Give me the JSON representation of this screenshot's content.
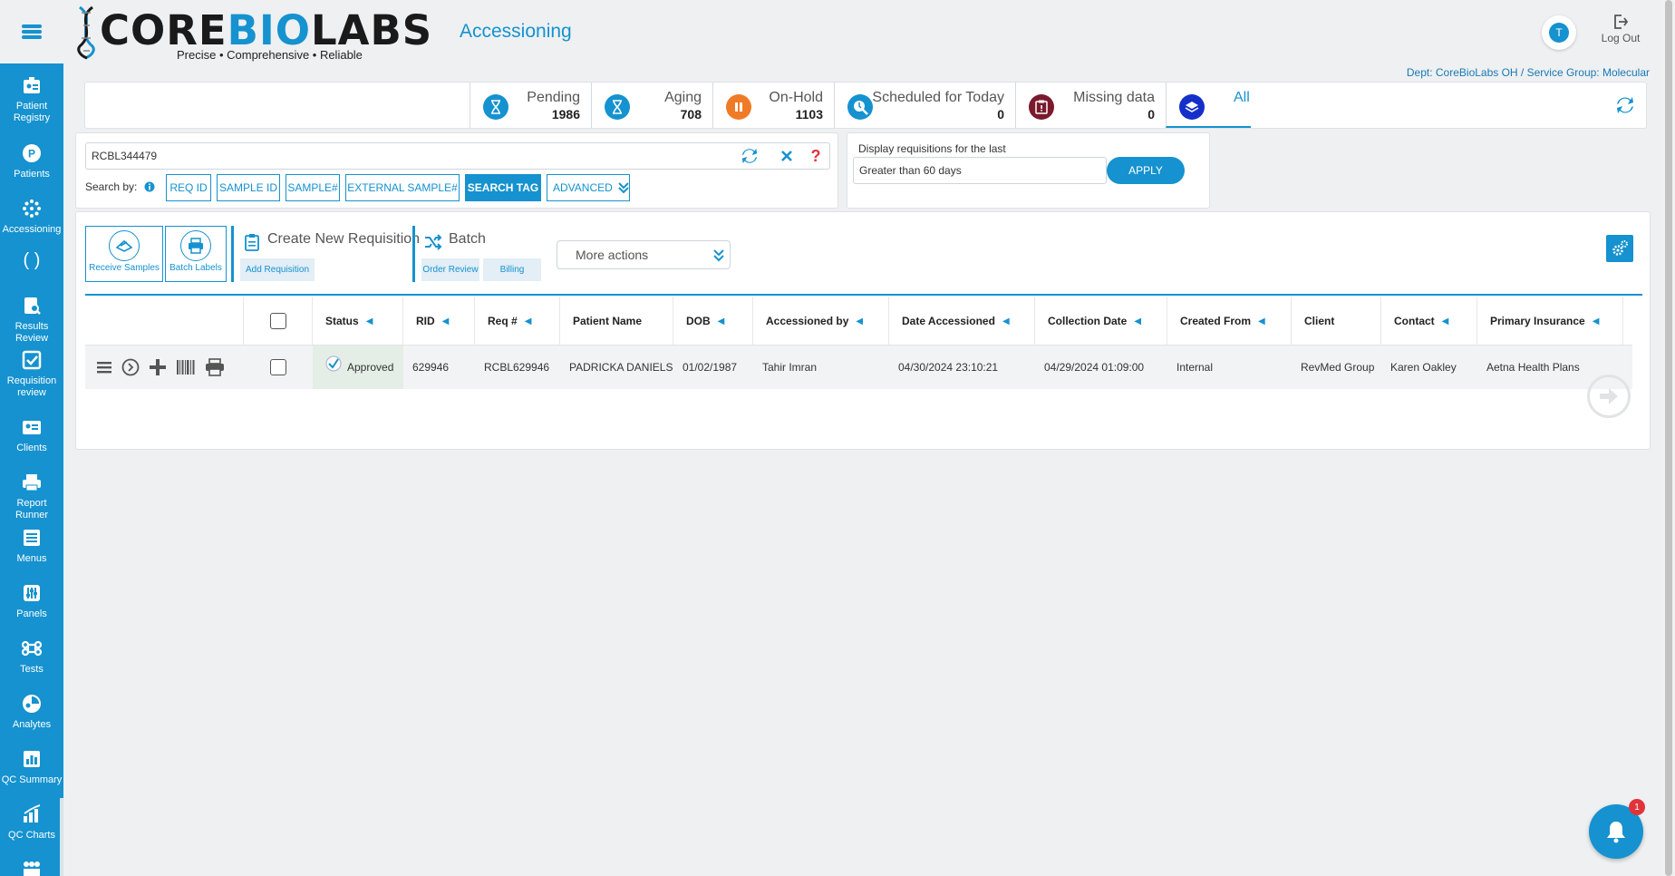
{
  "sidebar": {
    "items": [
      {
        "label": "Patient Registry",
        "icon": "patient-registry-icon"
      },
      {
        "label": "Patients",
        "icon": "patients-icon"
      },
      {
        "label": "Accessioning",
        "icon": "accessioning-icon"
      },
      {
        "label": "( )",
        "icon": "parentheses-icon"
      },
      {
        "label": "Results Review",
        "icon": "results-review-icon"
      },
      {
        "label": "Requisition review",
        "icon": "requisition-review-icon"
      },
      {
        "label": "Clients",
        "icon": "clients-icon"
      },
      {
        "label": "Report Runner",
        "icon": "report-runner-icon"
      },
      {
        "label": "Menus",
        "icon": "menus-icon"
      },
      {
        "label": "Panels",
        "icon": "panels-icon"
      },
      {
        "label": "Tests",
        "icon": "tests-icon"
      },
      {
        "label": "Analytes",
        "icon": "analytes-icon"
      },
      {
        "label": "QC Summary",
        "icon": "qc-summary-icon"
      },
      {
        "label": "QC Charts",
        "icon": "qc-charts-icon"
      }
    ]
  },
  "header": {
    "logo_part1": "CORE",
    "logo_part2": "BIO",
    "logo_part3": "LABS",
    "tagline": "Precise • Comprehensive • Reliable",
    "module_title": "Accessioning",
    "avatar_initial": "T",
    "logout_label": "Log Out",
    "dept": "Dept: CoreBioLabs OH / Service Group: Molecular"
  },
  "status_bar": {
    "pending": {
      "label": "Pending",
      "count": "1986"
    },
    "aging": {
      "label": "Aging",
      "count": "708"
    },
    "onhold": {
      "label": "On-Hold",
      "count": "1103"
    },
    "scheduled": {
      "label": "Scheduled for Today",
      "count": "0"
    },
    "missing": {
      "label": "Missing data",
      "count": "0"
    },
    "all": {
      "label": "All"
    }
  },
  "search": {
    "value": "RCBL344479",
    "search_by_label": "Search by:",
    "buttons": [
      "REQ ID",
      "SAMPLE ID",
      "SAMPLE#",
      "EXTERNAL SAMPLE#",
      "SEARCH TAG",
      "ADVANCED"
    ]
  },
  "date_filter": {
    "label": "Display requisitions for the last",
    "value": "Greater than 60 days",
    "apply_label": "APPLY"
  },
  "actions": {
    "receive_samples": "Receive Samples",
    "batch_labels": "Batch Labels",
    "create_requisition": "Create New Requisition",
    "add_requisition": "Add Requisition",
    "batch": "Batch",
    "order_review": "Order Review",
    "billing": "Billing",
    "more_actions": "More actions"
  },
  "table": {
    "headers": {
      "status": "Status",
      "rid": "RID",
      "req": "Req #",
      "patient": "Patient Name",
      "dob": "DOB",
      "accessioned_by": "Accessioned by",
      "date_accessioned": "Date Accessioned",
      "collection_date": "Collection Date",
      "created_from": "Created From",
      "client": "Client",
      "contact": "Contact",
      "insurance": "Primary Insurance"
    },
    "rows": [
      {
        "status": "Approved",
        "rid": "629946",
        "req": "RCBL629946",
        "patient": "PADRICKA DANIELS",
        "dob": "01/02/1987",
        "accessioned_by": "Tahir Imran",
        "date_accessioned": "04/30/2024 23:10:21",
        "collection_date": "04/29/2024 01:09:00",
        "created_from": "Internal",
        "client": "RevMed Group",
        "contact": "Karen Oakley",
        "insurance": "Aetna Health Plans"
      }
    ]
  },
  "notifications": {
    "count": "1"
  },
  "colors": {
    "accent": "#1592cf",
    "onhold": "#f07b26",
    "missing": "#7a1a2c",
    "approved_bg": "#e4eee7"
  }
}
